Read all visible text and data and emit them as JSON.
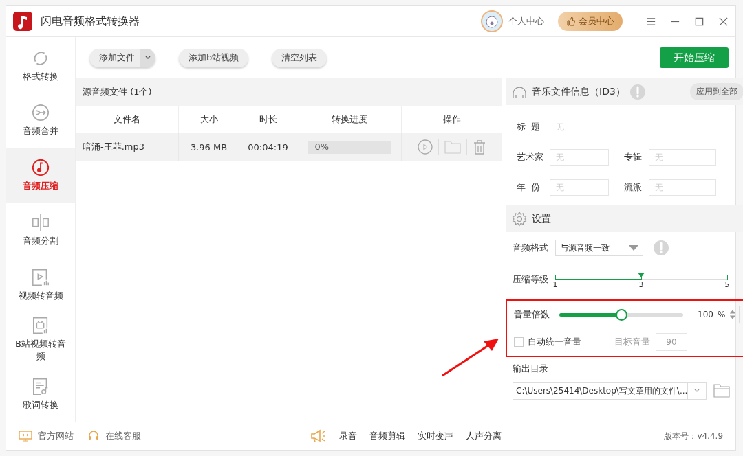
{
  "window": {
    "title": "闪电音频格式转换器"
  },
  "header": {
    "user_center": "个人中心",
    "vip_center": "会员中心"
  },
  "sidebar": {
    "items": [
      {
        "label": "格式转换",
        "selected": false
      },
      {
        "label": "音频合并",
        "selected": false
      },
      {
        "label": "音频压缩",
        "selected": true
      },
      {
        "label": "音频分割",
        "selected": false
      },
      {
        "label": "视频转音频",
        "selected": false
      },
      {
        "label": "B站视频转音频",
        "selected": false
      },
      {
        "label": "歌词转换",
        "selected": false
      }
    ]
  },
  "toolbar": {
    "add_file": "添加文件",
    "add_bilibili": "添加b站视频",
    "clear_list": "清空列表",
    "start": "开始压缩"
  },
  "file_list": {
    "title": "源音频文件 (1个)",
    "columns": [
      "文件名",
      "大小",
      "时长",
      "转换进度",
      "操作"
    ],
    "rows": [
      {
        "name": "暗涌-王菲.mp3",
        "size": "3.96 MB",
        "duration": "00:04:19",
        "progress": "0%",
        "level": 0
      }
    ]
  },
  "id3": {
    "title": "音乐文件信息（ID3）",
    "apply_all": "应用到全部",
    "fields": [
      {
        "label": "标  题",
        "placeholder": "无"
      },
      {
        "label": "艺术家",
        "placeholder": "无"
      },
      {
        "label": "专辑",
        "placeholder": "无"
      },
      {
        "label": "年  份",
        "placeholder": "无"
      },
      {
        "label": "流派",
        "placeholder": "无"
      }
    ]
  },
  "settings": {
    "title": "设置",
    "format_label": "音频格式",
    "format_value": "与源音频一致",
    "compress_label": "压缩等级",
    "compress": {
      "level": 0.5,
      "ticks": [
        "1",
        "3",
        "5"
      ]
    },
    "volume_label": "音量倍数",
    "volume": {
      "level": 0.5,
      "value": "100",
      "unit": "%"
    },
    "auto_volume": {
      "label": "自动统一音量",
      "checked": false,
      "target_label": "目标音量",
      "target_value": "90"
    },
    "output_label": "输出目录",
    "output_path": "C:\\Users\\25414\\Desktop\\写文章用的文件\\..."
  },
  "footer": {
    "links": [
      "官方网站",
      "在线客服"
    ],
    "tools": [
      "录音",
      "音频剪辑",
      "实时变声",
      "人声分离"
    ],
    "version": "版本号：v4.4.9"
  }
}
